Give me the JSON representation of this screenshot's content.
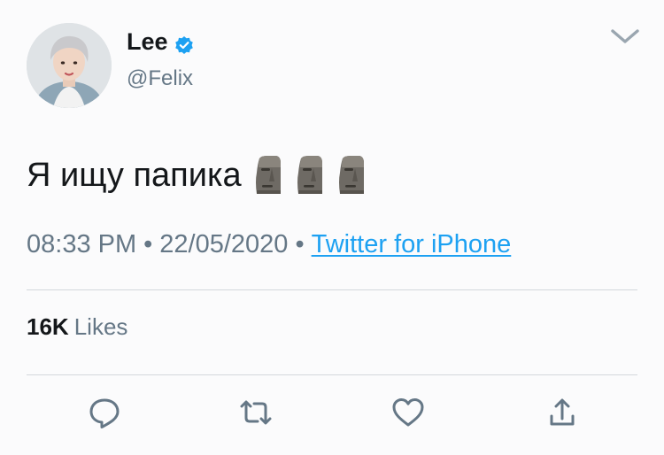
{
  "tweet": {
    "display_name": "Lee",
    "verified": true,
    "handle": "@Felix",
    "text": "Я ищу папика",
    "emoji": [
      "moai-emoji",
      "moai-emoji",
      "moai-emoji"
    ],
    "time": "08:33 PM",
    "separator": "•",
    "date": "22/05/2020",
    "source": "Twitter for iPhone",
    "likes_count": "16K",
    "likes_label": "Likes"
  },
  "icons": {
    "verified": "verified-badge-icon",
    "caret": "chevron-down-icon",
    "reply": "reply-icon",
    "retweet": "retweet-icon",
    "like": "heart-icon",
    "share": "share-icon"
  },
  "colors": {
    "accent": "#1da1f2",
    "text": "#14171a",
    "muted": "#657786",
    "icon": "#657786",
    "background": "#fbfbfc"
  }
}
